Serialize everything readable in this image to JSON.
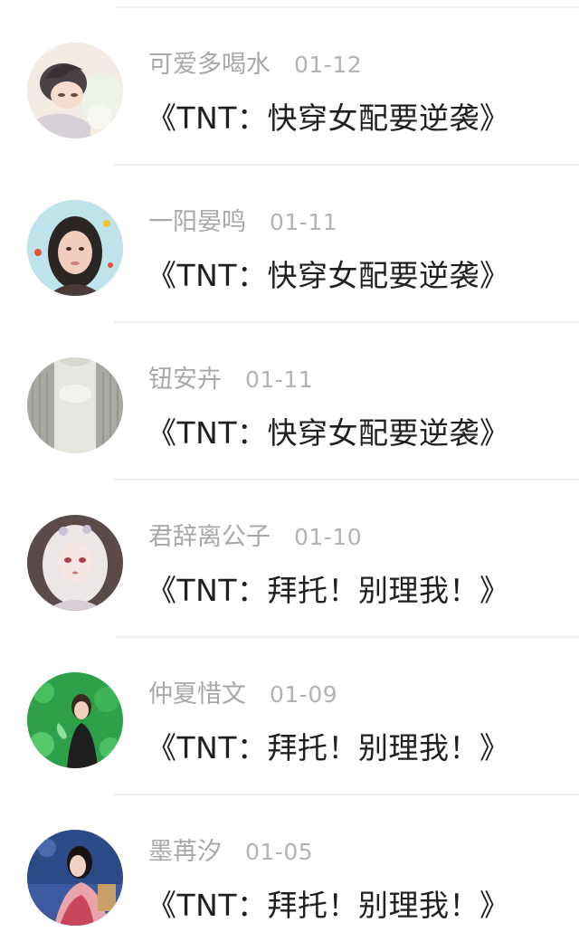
{
  "feed": {
    "items": [
      {
        "username": "可爱多喝水",
        "date": "01-12",
        "title": "《TNT：快穿女配要逆袭》",
        "avatar_icon": "anime-avatar"
      },
      {
        "username": "一阳晏鸣",
        "date": "01-11",
        "title": "《TNT：快穿女配要逆袭》",
        "avatar_icon": "portrait-avatar"
      },
      {
        "username": "钮安卉",
        "date": "01-11",
        "title": "《TNT：快穿女配要逆袭》",
        "avatar_icon": "curtain-avatar"
      },
      {
        "username": "君辞离公子",
        "date": "01-10",
        "title": "《TNT：拜托！别理我！》",
        "avatar_icon": "anime-girl-avatar"
      },
      {
        "username": "仲夏惜文",
        "date": "01-09",
        "title": "《TNT：拜托！别理我！》",
        "avatar_icon": "green-portrait-avatar"
      },
      {
        "username": "墨苒汐",
        "date": "01-05",
        "title": "《TNT：拜托！别理我！》",
        "avatar_icon": "costume-portrait-avatar"
      }
    ]
  }
}
